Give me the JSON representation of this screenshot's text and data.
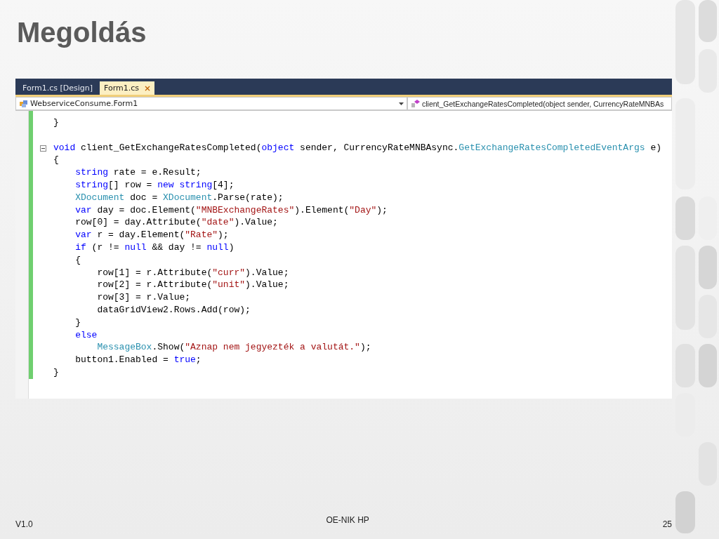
{
  "slide": {
    "title": "Megoldás"
  },
  "editor": {
    "tabs": [
      {
        "label": "Form1.cs [Design]",
        "selected": false
      },
      {
        "label": "Form1.cs",
        "selected": true
      }
    ],
    "type_dropdown": "WebserviceConsume.Form1",
    "member_dropdown": "client_GetExchangeRatesCompleted(object sender, CurrencyRateMNBAs",
    "code_lines": [
      {
        "kind": "code",
        "tokens": [
          {
            "kind": "plain",
            "text": "}"
          }
        ]
      },
      {
        "kind": "blank"
      },
      {
        "kind": "code",
        "fold": true,
        "tokens": [
          {
            "kind": "kw",
            "text": "void"
          },
          {
            "kind": "plain",
            "text": " client_GetExchangeRatesCompleted("
          },
          {
            "kind": "kw",
            "text": "object"
          },
          {
            "kind": "plain",
            "text": " sender, CurrencyRateMNBAsync."
          },
          {
            "kind": "type",
            "text": "GetExchangeRatesCompletedEventArgs"
          },
          {
            "kind": "plain",
            "text": " e)"
          }
        ]
      },
      {
        "kind": "code",
        "tokens": [
          {
            "kind": "plain",
            "text": "{"
          }
        ]
      },
      {
        "kind": "code",
        "tokens": [
          {
            "kind": "kw",
            "text": "    string"
          },
          {
            "kind": "plain",
            "text": " rate = e.Result;"
          }
        ]
      },
      {
        "kind": "code",
        "tokens": [
          {
            "kind": "kw",
            "text": "    string"
          },
          {
            "kind": "plain",
            "text": "[] row = "
          },
          {
            "kind": "kw",
            "text": "new string"
          },
          {
            "kind": "plain",
            "text": "[4];"
          }
        ]
      },
      {
        "kind": "code",
        "tokens": [
          {
            "kind": "type",
            "text": "    XDocument"
          },
          {
            "kind": "plain",
            "text": " doc = "
          },
          {
            "kind": "type",
            "text": "XDocument"
          },
          {
            "kind": "plain",
            "text": ".Parse(rate);"
          }
        ]
      },
      {
        "kind": "code",
        "tokens": [
          {
            "kind": "kw",
            "text": "    var"
          },
          {
            "kind": "plain",
            "text": " day = doc.Element("
          },
          {
            "kind": "str",
            "text": "\"MNBExchangeRates\""
          },
          {
            "kind": "plain",
            "text": ").Element("
          },
          {
            "kind": "str",
            "text": "\"Day\""
          },
          {
            "kind": "plain",
            "text": ");"
          }
        ]
      },
      {
        "kind": "code",
        "tokens": [
          {
            "kind": "plain",
            "text": "    row[0] = day.Attribute("
          },
          {
            "kind": "str",
            "text": "\"date\""
          },
          {
            "kind": "plain",
            "text": ").Value;"
          }
        ]
      },
      {
        "kind": "code",
        "tokens": [
          {
            "kind": "kw",
            "text": "    var"
          },
          {
            "kind": "plain",
            "text": " r = day.Element("
          },
          {
            "kind": "str",
            "text": "\"Rate\""
          },
          {
            "kind": "plain",
            "text": ");"
          }
        ]
      },
      {
        "kind": "code",
        "tokens": [
          {
            "kind": "kw",
            "text": "    if"
          },
          {
            "kind": "plain",
            "text": " (r != "
          },
          {
            "kind": "kw",
            "text": "null"
          },
          {
            "kind": "plain",
            "text": " && day != "
          },
          {
            "kind": "kw",
            "text": "null"
          },
          {
            "kind": "plain",
            "text": ")"
          }
        ]
      },
      {
        "kind": "code",
        "tokens": [
          {
            "kind": "plain",
            "text": "    {"
          }
        ]
      },
      {
        "kind": "code",
        "tokens": [
          {
            "kind": "plain",
            "text": "        row[1] = r.Attribute("
          },
          {
            "kind": "str",
            "text": "\"curr\""
          },
          {
            "kind": "plain",
            "text": ").Value;"
          }
        ]
      },
      {
        "kind": "code",
        "tokens": [
          {
            "kind": "plain",
            "text": "        row[2] = r.Attribute("
          },
          {
            "kind": "str",
            "text": "\"unit\""
          },
          {
            "kind": "plain",
            "text": ").Value;"
          }
        ]
      },
      {
        "kind": "code",
        "tokens": [
          {
            "kind": "plain",
            "text": "        row[3] = r.Value;"
          }
        ]
      },
      {
        "kind": "code",
        "tokens": [
          {
            "kind": "plain",
            "text": "        dataGridView2.Rows.Add(row);"
          }
        ]
      },
      {
        "kind": "code",
        "tokens": [
          {
            "kind": "plain",
            "text": "    }"
          }
        ]
      },
      {
        "kind": "code",
        "tokens": [
          {
            "kind": "kw",
            "text": "    else"
          }
        ]
      },
      {
        "kind": "code",
        "tokens": [
          {
            "kind": "type",
            "text": "        MessageBox"
          },
          {
            "kind": "plain",
            "text": ".Show("
          },
          {
            "kind": "str",
            "text": "\"Aznap nem jegyezték a valutát.\""
          },
          {
            "kind": "plain",
            "text": ");"
          }
        ]
      },
      {
        "kind": "code",
        "tokens": [
          {
            "kind": "plain",
            "text": "    button1.Enabled = "
          },
          {
            "kind": "kw",
            "text": "true"
          },
          {
            "kind": "plain",
            "text": ";"
          }
        ]
      },
      {
        "kind": "code",
        "tokens": [
          {
            "kind": "plain",
            "text": "}"
          }
        ]
      }
    ]
  },
  "footer": {
    "version": "V1.0",
    "center": "OE-NIK HP",
    "page": "25"
  }
}
